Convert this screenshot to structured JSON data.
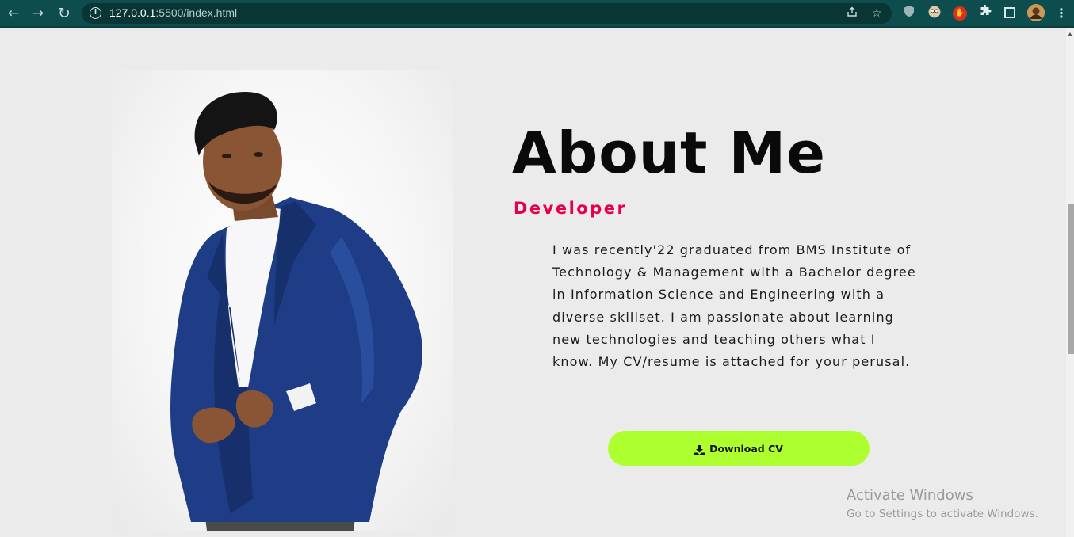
{
  "browser": {
    "url_host": "127.0.0.1",
    "url_rest": ":5500/index.html",
    "nav": {
      "back": "←",
      "forward": "→",
      "reload": "↻"
    },
    "icons": [
      "share-icon",
      "bookmark-star-icon",
      "shield-extension-icon",
      "face-extension-icon",
      "stop-hand-extension-icon",
      "puzzle-extensions-icon",
      "side-panel-icon",
      "profile-avatar",
      "kebab-menu-icon"
    ]
  },
  "about": {
    "title": "About Me",
    "subtitle": "Developer",
    "bio": "I was recently'22 graduated from BMS Institute of Technology & Management with a Bachelor degree in Information Science and Engineering with a diverse skillset. I am passionate about learning new technologies and teaching others what I know. My CV/resume is attached for your perusal.",
    "button_label": "Download CV"
  },
  "watermark": {
    "title": "Activate Windows",
    "subtitle": "Go to Settings to activate Windows."
  },
  "colors": {
    "accent": "#e6004c",
    "button": "#adff2f",
    "chrome": "#0d4d4d",
    "background": "#ebebeb"
  }
}
